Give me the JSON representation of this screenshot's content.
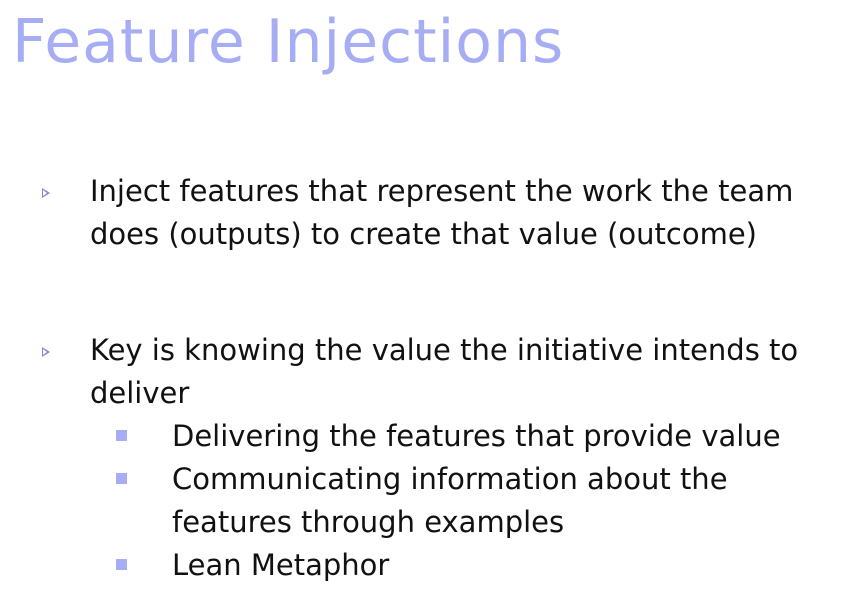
{
  "slide": {
    "title": "Feature Injections",
    "bullets": [
      {
        "text": "Inject features that represent the work the team does (outputs) to create that value (outcome)",
        "sub_bullets": []
      },
      {
        "text": "Key is knowing the value the initiative intends to deliver",
        "sub_bullets": [
          "Delivering the features that provide value",
          "Communicating information about the features through examples",
          "Lean Metaphor"
        ]
      }
    ]
  },
  "colors": {
    "title": "#a6adf5",
    "bullet_marker": "#7f89d6",
    "sub_bullet_marker": "#a6adf5",
    "body_text": "#111111",
    "background": "#ffffff"
  },
  "icons": {
    "level1_marker": "triangle-bullet-icon",
    "level2_marker": "square-bullet-icon"
  }
}
